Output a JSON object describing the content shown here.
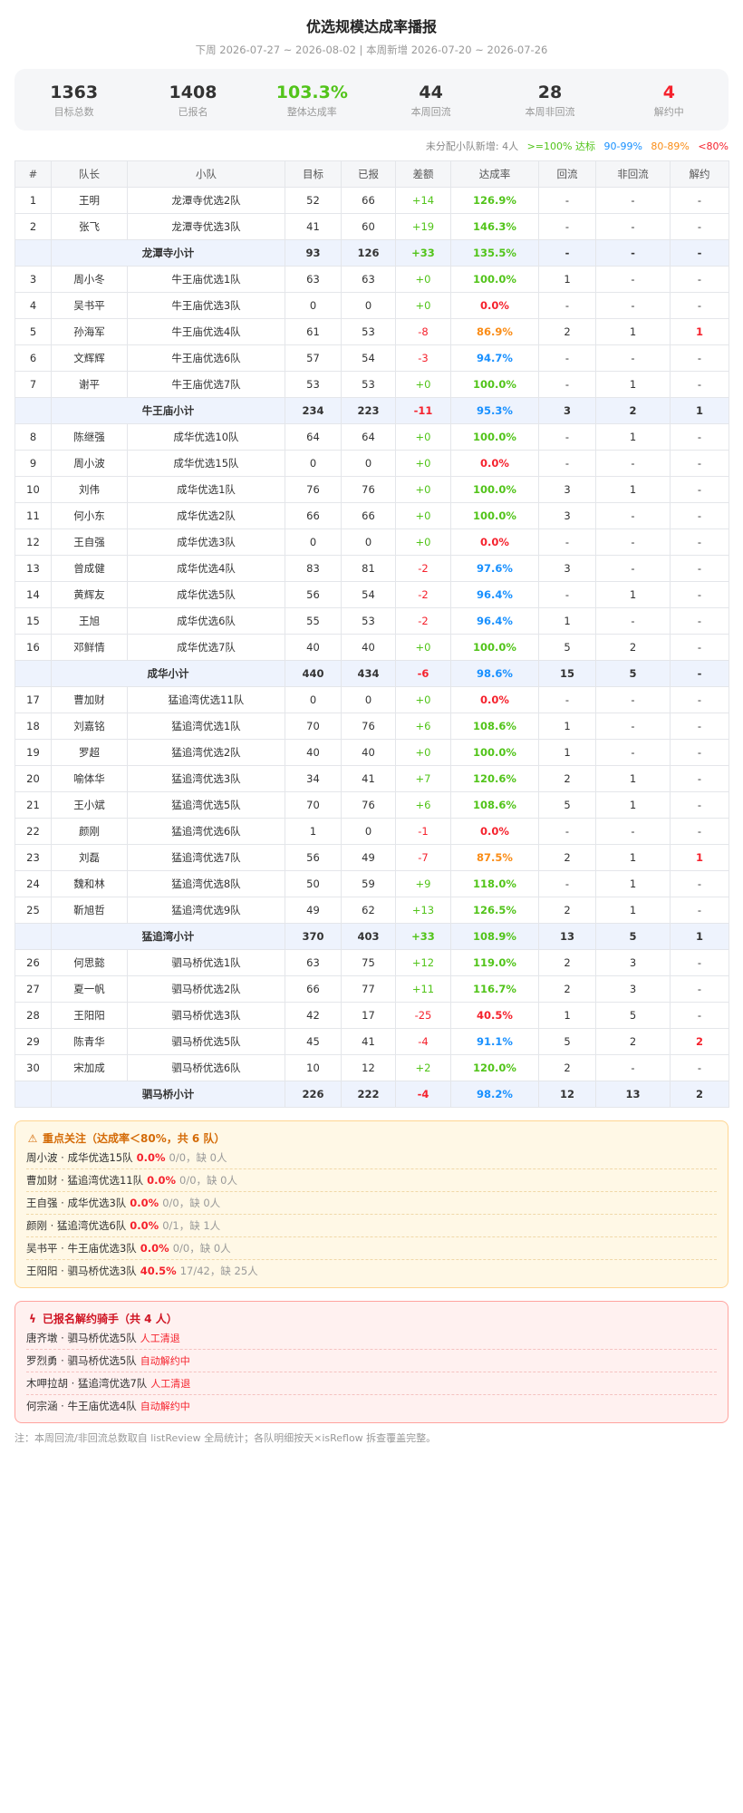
{
  "header": {
    "title": "优选规模达成率播报",
    "subtitle": "下周 2026-07-27 ~ 2026-08-02 | 本周新增 2026-07-20 ~ 2026-07-26"
  },
  "stats": [
    {
      "value": "1363",
      "label": "目标总数",
      "color": "#333333"
    },
    {
      "value": "1408",
      "label": "已报名",
      "color": "#333333"
    },
    {
      "value": "103.3%",
      "label": "整体达成率",
      "color": "#52c41a"
    },
    {
      "value": "44",
      "label": "本周回流",
      "color": "#333333"
    },
    {
      "value": "28",
      "label": "本周非回流",
      "color": "#333333"
    },
    {
      "value": "4",
      "label": "解约中",
      "color": "#f5222d"
    }
  ],
  "legend": {
    "text": "未分配小队新增: 4人",
    "items": [
      {
        "label": ">=100% 达标",
        "color": "#52c41a"
      },
      {
        "label": "90-99%",
        "color": "#1890ff"
      },
      {
        "label": "80-89%",
        "color": "#fa8c16"
      },
      {
        "label": "<80%",
        "color": "#f5222d"
      }
    ]
  },
  "table": {
    "columns": [
      "#",
      "队长",
      "小队",
      "目标",
      "已报",
      "差额",
      "达成率",
      "回流",
      "非回流",
      "解约"
    ],
    "rows": [
      {
        "type": "row",
        "no": "1",
        "captain": "王明",
        "team": "龙潭寺优选2队",
        "target": "52",
        "signed": "66",
        "diff": "+14",
        "rate": "126.9%",
        "back": "-",
        "nonback": "-",
        "cancel": "-"
      },
      {
        "type": "row",
        "no": "2",
        "captain": "张飞",
        "team": "龙潭寺优选3队",
        "target": "41",
        "signed": "60",
        "diff": "+19",
        "rate": "146.3%",
        "back": "-",
        "nonback": "-",
        "cancel": "-"
      },
      {
        "type": "sub",
        "label": "龙潭寺小计",
        "target": "93",
        "signed": "126",
        "diff": "+33",
        "rate": "135.5%",
        "back": "-",
        "nonback": "-",
        "cancel": "-"
      },
      {
        "type": "row",
        "no": "3",
        "captain": "周小冬",
        "team": "牛王庙优选1队",
        "target": "63",
        "signed": "63",
        "diff": "+0",
        "rate": "100.0%",
        "back": "1",
        "nonback": "-",
        "cancel": "-"
      },
      {
        "type": "row",
        "no": "4",
        "captain": "吴书平",
        "team": "牛王庙优选3队",
        "target": "0",
        "signed": "0",
        "diff": "+0",
        "rate": "0.0%",
        "back": "-",
        "nonback": "-",
        "cancel": "-"
      },
      {
        "type": "row",
        "no": "5",
        "captain": "孙海军",
        "team": "牛王庙优选4队",
        "target": "61",
        "signed": "53",
        "diff": "-8",
        "rate": "86.9%",
        "back": "2",
        "nonback": "1",
        "cancel": "1"
      },
      {
        "type": "row",
        "no": "6",
        "captain": "文辉辉",
        "team": "牛王庙优选6队",
        "target": "57",
        "signed": "54",
        "diff": "-3",
        "rate": "94.7%",
        "back": "-",
        "nonback": "-",
        "cancel": "-"
      },
      {
        "type": "row",
        "no": "7",
        "captain": "谢平",
        "team": "牛王庙优选7队",
        "target": "53",
        "signed": "53",
        "diff": "+0",
        "rate": "100.0%",
        "back": "-",
        "nonback": "1",
        "cancel": "-"
      },
      {
        "type": "sub",
        "label": "牛王庙小计",
        "target": "234",
        "signed": "223",
        "diff": "-11",
        "rate": "95.3%",
        "back": "3",
        "nonback": "2",
        "cancel": "1"
      },
      {
        "type": "row",
        "no": "8",
        "captain": "陈继强",
        "team": "成华优选10队",
        "target": "64",
        "signed": "64",
        "diff": "+0",
        "rate": "100.0%",
        "back": "-",
        "nonback": "1",
        "cancel": "-"
      },
      {
        "type": "row",
        "no": "9",
        "captain": "周小波",
        "team": "成华优选15队",
        "target": "0",
        "signed": "0",
        "diff": "+0",
        "rate": "0.0%",
        "back": "-",
        "nonback": "-",
        "cancel": "-"
      },
      {
        "type": "row",
        "no": "10",
        "captain": "刘伟",
        "team": "成华优选1队",
        "target": "76",
        "signed": "76",
        "diff": "+0",
        "rate": "100.0%",
        "back": "3",
        "nonback": "1",
        "cancel": "-"
      },
      {
        "type": "row",
        "no": "11",
        "captain": "何小东",
        "team": "成华优选2队",
        "target": "66",
        "signed": "66",
        "diff": "+0",
        "rate": "100.0%",
        "back": "3",
        "nonback": "-",
        "cancel": "-"
      },
      {
        "type": "row",
        "no": "12",
        "captain": "王自强",
        "team": "成华优选3队",
        "target": "0",
        "signed": "0",
        "diff": "+0",
        "rate": "0.0%",
        "back": "-",
        "nonback": "-",
        "cancel": "-"
      },
      {
        "type": "row",
        "no": "13",
        "captain": "曾成健",
        "team": "成华优选4队",
        "target": "83",
        "signed": "81",
        "diff": "-2",
        "rate": "97.6%",
        "back": "3",
        "nonback": "-",
        "cancel": "-"
      },
      {
        "type": "row",
        "no": "14",
        "captain": "黄辉友",
        "team": "成华优选5队",
        "target": "56",
        "signed": "54",
        "diff": "-2",
        "rate": "96.4%",
        "back": "-",
        "nonback": "1",
        "cancel": "-"
      },
      {
        "type": "row",
        "no": "15",
        "captain": "王旭",
        "team": "成华优选6队",
        "target": "55",
        "signed": "53",
        "diff": "-2",
        "rate": "96.4%",
        "back": "1",
        "nonback": "-",
        "cancel": "-"
      },
      {
        "type": "row",
        "no": "16",
        "captain": "邓鲜情",
        "team": "成华优选7队",
        "target": "40",
        "signed": "40",
        "diff": "+0",
        "rate": "100.0%",
        "back": "5",
        "nonback": "2",
        "cancel": "-"
      },
      {
        "type": "sub",
        "label": "成华小计",
        "target": "440",
        "signed": "434",
        "diff": "-6",
        "rate": "98.6%",
        "back": "15",
        "nonback": "5",
        "cancel": "-"
      },
      {
        "type": "row",
        "no": "17",
        "captain": "曹加财",
        "team": "猛追湾优选11队",
        "target": "0",
        "signed": "0",
        "diff": "+0",
        "rate": "0.0%",
        "back": "-",
        "nonback": "-",
        "cancel": "-"
      },
      {
        "type": "row",
        "no": "18",
        "captain": "刘嘉铭",
        "team": "猛追湾优选1队",
        "target": "70",
        "signed": "76",
        "diff": "+6",
        "rate": "108.6%",
        "back": "1",
        "nonback": "-",
        "cancel": "-"
      },
      {
        "type": "row",
        "no": "19",
        "captain": "罗超",
        "team": "猛追湾优选2队",
        "target": "40",
        "signed": "40",
        "diff": "+0",
        "rate": "100.0%",
        "back": "1",
        "nonback": "-",
        "cancel": "-"
      },
      {
        "type": "row",
        "no": "20",
        "captain": "喻体华",
        "team": "猛追湾优选3队",
        "target": "34",
        "signed": "41",
        "diff": "+7",
        "rate": "120.6%",
        "back": "2",
        "nonback": "1",
        "cancel": "-"
      },
      {
        "type": "row",
        "no": "21",
        "captain": "王小斌",
        "team": "猛追湾优选5队",
        "target": "70",
        "signed": "76",
        "diff": "+6",
        "rate": "108.6%",
        "back": "5",
        "nonback": "1",
        "cancel": "-"
      },
      {
        "type": "row",
        "no": "22",
        "captain": "颜刚",
        "team": "猛追湾优选6队",
        "target": "1",
        "signed": "0",
        "diff": "-1",
        "rate": "0.0%",
        "back": "-",
        "nonback": "-",
        "cancel": "-"
      },
      {
        "type": "row",
        "no": "23",
        "captain": "刘磊",
        "team": "猛追湾优选7队",
        "target": "56",
        "signed": "49",
        "diff": "-7",
        "rate": "87.5%",
        "back": "2",
        "nonback": "1",
        "cancel": "1"
      },
      {
        "type": "row",
        "no": "24",
        "captain": "魏和林",
        "team": "猛追湾优选8队",
        "target": "50",
        "signed": "59",
        "diff": "+9",
        "rate": "118.0%",
        "back": "-",
        "nonback": "1",
        "cancel": "-"
      },
      {
        "type": "row",
        "no": "25",
        "captain": "靳旭哲",
        "team": "猛追湾优选9队",
        "target": "49",
        "signed": "62",
        "diff": "+13",
        "rate": "126.5%",
        "back": "2",
        "nonback": "1",
        "cancel": "-"
      },
      {
        "type": "sub",
        "label": "猛追湾小计",
        "target": "370",
        "signed": "403",
        "diff": "+33",
        "rate": "108.9%",
        "back": "13",
        "nonback": "5",
        "cancel": "1"
      },
      {
        "type": "row",
        "no": "26",
        "captain": "何思懿",
        "team": "驷马桥优选1队",
        "target": "63",
        "signed": "75",
        "diff": "+12",
        "rate": "119.0%",
        "back": "2",
        "nonback": "3",
        "cancel": "-"
      },
      {
        "type": "row",
        "no": "27",
        "captain": "夏一帆",
        "team": "驷马桥优选2队",
        "target": "66",
        "signed": "77",
        "diff": "+11",
        "rate": "116.7%",
        "back": "2",
        "nonback": "3",
        "cancel": "-"
      },
      {
        "type": "row",
        "no": "28",
        "captain": "王阳阳",
        "team": "驷马桥优选3队",
        "target": "42",
        "signed": "17",
        "diff": "-25",
        "rate": "40.5%",
        "back": "1",
        "nonback": "5",
        "cancel": "-"
      },
      {
        "type": "row",
        "no": "29",
        "captain": "陈青华",
        "team": "驷马桥优选5队",
        "target": "45",
        "signed": "41",
        "diff": "-4",
        "rate": "91.1%",
        "back": "5",
        "nonback": "2",
        "cancel": "2"
      },
      {
        "type": "row",
        "no": "30",
        "captain": "宋加成",
        "team": "驷马桥优选6队",
        "target": "10",
        "signed": "12",
        "diff": "+2",
        "rate": "120.0%",
        "back": "2",
        "nonback": "-",
        "cancel": "-"
      },
      {
        "type": "sub",
        "label": "驷马桥小计",
        "target": "226",
        "signed": "222",
        "diff": "-4",
        "rate": "98.2%",
        "back": "12",
        "nonback": "13",
        "cancel": "2"
      }
    ]
  },
  "focus": {
    "title": "重点关注（达成率＜80%，共 6 队）",
    "items": [
      {
        "name": "周小波 · 成华优选15队",
        "rate": "0.0%",
        "meta": "0/0，缺 0人"
      },
      {
        "name": "曹加财 · 猛追湾优选11队",
        "rate": "0.0%",
        "meta": "0/0，缺 0人"
      },
      {
        "name": "王自强 · 成华优选3队",
        "rate": "0.0%",
        "meta": "0/0，缺 0人"
      },
      {
        "name": "颜刚 · 猛追湾优选6队",
        "rate": "0.0%",
        "meta": "0/1，缺 1人"
      },
      {
        "name": "吴书平 · 牛王庙优选3队",
        "rate": "0.0%",
        "meta": "0/0，缺 0人"
      },
      {
        "name": "王阳阳 · 驷马桥优选3队",
        "rate": "40.5%",
        "meta": "17/42，缺 25人"
      }
    ]
  },
  "cancel": {
    "title": "已报名解约骑手（共 4 人）",
    "items": [
      {
        "name": "唐齐墩 · 驷马桥优选5队",
        "status": "人工清退"
      },
      {
        "name": "罗烈勇 · 驷马桥优选5队",
        "status": "自动解约中"
      },
      {
        "name": "木呷拉胡 · 猛追湾优选7队",
        "status": "人工清退"
      },
      {
        "name": "何宗涵 · 牛王庙优选4队",
        "status": "自动解约中"
      }
    ]
  },
  "note": "注：本周回流/非回流总数取自 listReview 全局统计；各队明细按天×isReflow 拆查覆盖完整。"
}
